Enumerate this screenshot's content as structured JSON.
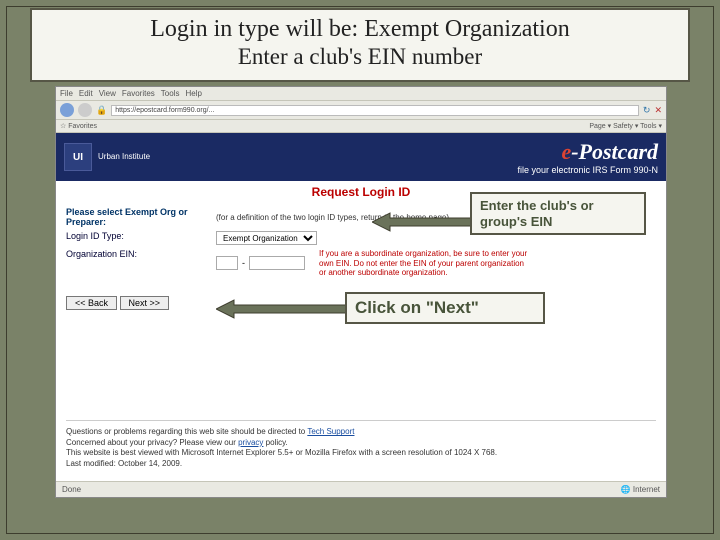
{
  "slide": {
    "title_line1": "Login in type will be: Exempt Organization",
    "title_line2": "Enter a club's EIN number"
  },
  "callouts": {
    "ein": "Enter the club's or group's EIN",
    "next": "Click on \"Next\""
  },
  "browser": {
    "menu": [
      "File",
      "Edit",
      "View",
      "Favorites",
      "Tools",
      "Help"
    ],
    "address": "https://epostcard.form990.org/...",
    "toolbar_right": "Page ▾   Safety ▾   Tools ▾"
  },
  "banner": {
    "org_name": "Urban Institute",
    "brand_e": "e",
    "brand_rest": "-Postcard",
    "brand_sub": "file your electronic IRS Form 990-N"
  },
  "page": {
    "heading": "Request Login ID",
    "prompt_label": "Please select Exempt Org or Preparer:",
    "login_type_label": "Login ID Type:",
    "login_type_value": "Exempt Organization",
    "ein_label": "Organization EIN:",
    "ein_prefix": "",
    "ein_main": "",
    "help_line": "(for a definition of the two login ID types, return to the home page)",
    "red_warning": "If you are a subordinate organization, be sure to enter your own EIN. Do not enter the EIN of your parent organization or another subordinate organization.",
    "back_btn": "<< Back",
    "next_btn": "Next >>"
  },
  "footer": {
    "line1_a": "Questions or problems regarding this web site should be directed to ",
    "line1_link": "Tech Support",
    "line2_a": "Concerned about your privacy? Please view our ",
    "line2_link": "privacy",
    "line2_b": " policy.",
    "line3": "This website is best viewed with Microsoft Internet Explorer 5.5+ or Mozilla Firefox with a screen resolution of 1024 X 768.",
    "line4": "Last modified: October 14, 2009."
  },
  "status": {
    "left": "Done",
    "right": "Internet"
  },
  "colors": {
    "arrow": "#6a725a",
    "arrow_border": "#3d3d2e"
  }
}
